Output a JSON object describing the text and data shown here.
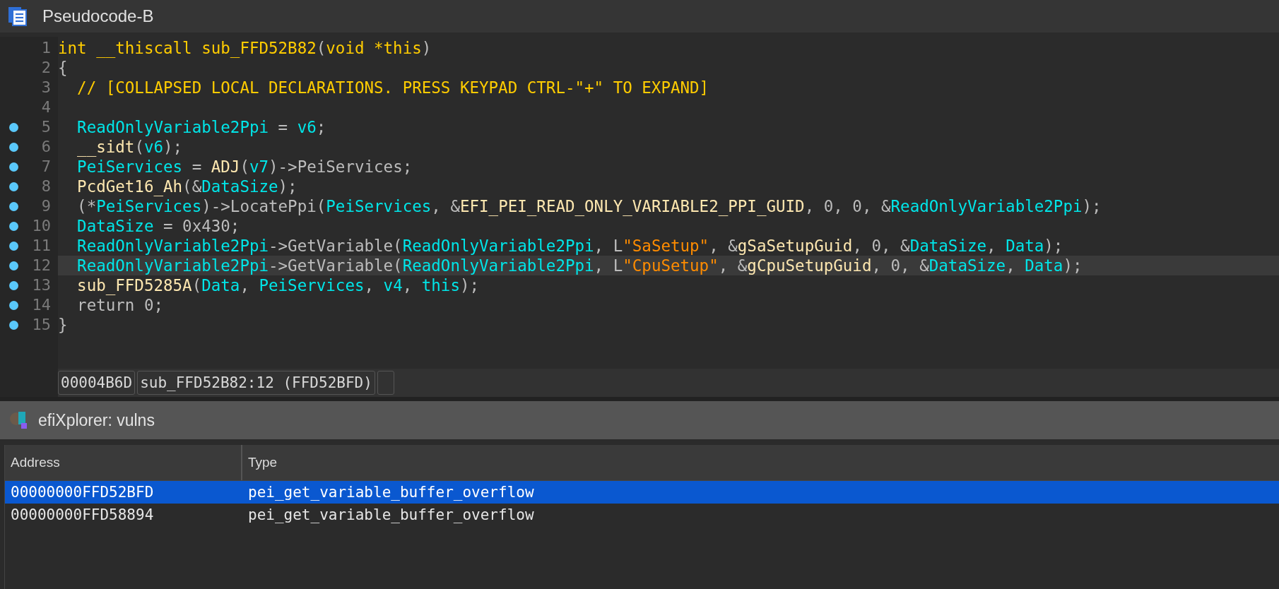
{
  "editor": {
    "title": "Pseudocode-B",
    "lines": [
      {
        "number": "1",
        "marked": false,
        "current": false,
        "tokens": [
          {
            "text": "int __thiscall sub_FFD52B82",
            "kind": "decl"
          },
          {
            "text": "(",
            "kind": "plain"
          },
          {
            "text": "void *this",
            "kind": "decl"
          },
          {
            "text": ")",
            "kind": "plain"
          }
        ]
      },
      {
        "number": "2",
        "marked": false,
        "current": false,
        "tokens": [
          {
            "text": "{",
            "kind": "plain"
          }
        ]
      },
      {
        "number": "3",
        "marked": false,
        "current": false,
        "tokens": [
          {
            "text": "  // [COLLAPSED LOCAL DECLARATIONS. PRESS KEYPAD CTRL-\"+\" TO EXPAND]",
            "kind": "comment"
          }
        ]
      },
      {
        "number": "4",
        "marked": false,
        "current": false
      },
      {
        "number": "5",
        "marked": true,
        "current": false,
        "tokens": [
          {
            "text": "  ReadOnlyVariable2Ppi",
            "kind": "var"
          },
          {
            "text": " = ",
            "kind": "plain"
          },
          {
            "text": "v6",
            "kind": "var"
          },
          {
            "text": ";",
            "kind": "plain"
          }
        ]
      },
      {
        "number": "6",
        "marked": true,
        "current": false,
        "tokens": [
          {
            "text": "  __sidt",
            "kind": "func"
          },
          {
            "text": "(",
            "kind": "plain"
          },
          {
            "text": "v6",
            "kind": "var"
          },
          {
            "text": ");",
            "kind": "plain"
          }
        ]
      },
      {
        "number": "7",
        "marked": true,
        "current": false,
        "tokens": [
          {
            "text": "  PeiServices",
            "kind": "var"
          },
          {
            "text": " = ",
            "kind": "plain"
          },
          {
            "text": "ADJ",
            "kind": "func"
          },
          {
            "text": "(",
            "kind": "plain"
          },
          {
            "text": "v7",
            "kind": "var"
          },
          {
            "text": ")->PeiServices;",
            "kind": "plain"
          }
        ]
      },
      {
        "number": "8",
        "marked": true,
        "current": false,
        "tokens": [
          {
            "text": "  PcdGet16_Ah",
            "kind": "func"
          },
          {
            "text": "(&",
            "kind": "plain"
          },
          {
            "text": "DataSize",
            "kind": "var"
          },
          {
            "text": ");",
            "kind": "plain"
          }
        ]
      },
      {
        "number": "9",
        "marked": true,
        "current": false,
        "tokens": [
          {
            "text": "  (*",
            "kind": "plain"
          },
          {
            "text": "PeiServices",
            "kind": "var"
          },
          {
            "text": ")->LocatePpi(",
            "kind": "plain"
          },
          {
            "text": "PeiServices",
            "kind": "var"
          },
          {
            "text": ", &",
            "kind": "plain"
          },
          {
            "text": "EFI_PEI_READ_ONLY_VARIABLE2_PPI_GUID",
            "kind": "func"
          },
          {
            "text": ", 0, 0, &",
            "kind": "plain"
          },
          {
            "text": "ReadOnlyVariable2Ppi",
            "kind": "var"
          },
          {
            "text": ");",
            "kind": "plain"
          }
        ]
      },
      {
        "number": "10",
        "marked": true,
        "current": false,
        "tokens": [
          {
            "text": "  DataSize",
            "kind": "var"
          },
          {
            "text": " = 0x430;",
            "kind": "plain"
          }
        ]
      },
      {
        "number": "11",
        "marked": true,
        "current": false,
        "tokens": [
          {
            "text": "  ReadOnlyVariable2Ppi",
            "kind": "var"
          },
          {
            "text": "->GetVariable(",
            "kind": "plain"
          },
          {
            "text": "ReadOnlyVariable2Ppi",
            "kind": "var"
          },
          {
            "text": ", L",
            "kind": "plain"
          },
          {
            "text": "\"SaSetup\"",
            "kind": "str"
          },
          {
            "text": ", &",
            "kind": "plain"
          },
          {
            "text": "gSaSetupGuid",
            "kind": "func"
          },
          {
            "text": ", 0, &",
            "kind": "plain"
          },
          {
            "text": "DataSize",
            "kind": "var"
          },
          {
            "text": ", ",
            "kind": "plain"
          },
          {
            "text": "Data",
            "kind": "var"
          },
          {
            "text": ");",
            "kind": "plain"
          }
        ]
      },
      {
        "number": "12",
        "marked": true,
        "current": true,
        "tokens": [
          {
            "text": "  ReadOnlyVariable2Ppi",
            "kind": "var"
          },
          {
            "text": "->GetVariable(",
            "kind": "plain"
          },
          {
            "text": "ReadOnlyVariable2Ppi",
            "kind": "var"
          },
          {
            "text": ", L",
            "kind": "plain"
          },
          {
            "text": "\"CpuSetup\"",
            "kind": "str"
          },
          {
            "text": ", &",
            "kind": "plain"
          },
          {
            "text": "gCpuSetupGuid",
            "kind": "func"
          },
          {
            "text": ", 0, &",
            "kind": "plain"
          },
          {
            "text": "DataSize",
            "kind": "var"
          },
          {
            "text": ", ",
            "kind": "plain"
          },
          {
            "text": "Data",
            "kind": "var"
          },
          {
            "text": ");",
            "kind": "plain"
          }
        ]
      },
      {
        "number": "13",
        "marked": true,
        "current": false,
        "tokens": [
          {
            "text": "  sub_FFD5285A",
            "kind": "func"
          },
          {
            "text": "(",
            "kind": "plain"
          },
          {
            "text": "Data",
            "kind": "var"
          },
          {
            "text": ", ",
            "kind": "plain"
          },
          {
            "text": "PeiServices",
            "kind": "var"
          },
          {
            "text": ", ",
            "kind": "plain"
          },
          {
            "text": "v4",
            "kind": "var"
          },
          {
            "text": ", ",
            "kind": "plain"
          },
          {
            "text": "this",
            "kind": "var"
          },
          {
            "text": ");",
            "kind": "plain"
          }
        ]
      },
      {
        "number": "14",
        "marked": true,
        "current": false,
        "tokens": [
          {
            "text": "  return 0;",
            "kind": "plain"
          }
        ]
      },
      {
        "number": "15",
        "marked": true,
        "current": false,
        "tokens": [
          {
            "text": "}",
            "kind": "plain"
          }
        ]
      }
    ],
    "status_bar": [
      "00004B6D",
      "sub_FFD52B82:12 (FFD52BFD)"
    ]
  },
  "vulns_panel": {
    "title": "efiXplorer: vulns",
    "table": {
      "columns": [
        "Address",
        "Type"
      ],
      "rows": [
        {
          "address": "00000000FFD52BFD",
          "type": "pei_get_variable_buffer_overflow",
          "selected": true
        },
        {
          "address": "00000000FFD58894",
          "type": "pei_get_variable_buffer_overflow",
          "selected": false
        }
      ]
    }
  }
}
